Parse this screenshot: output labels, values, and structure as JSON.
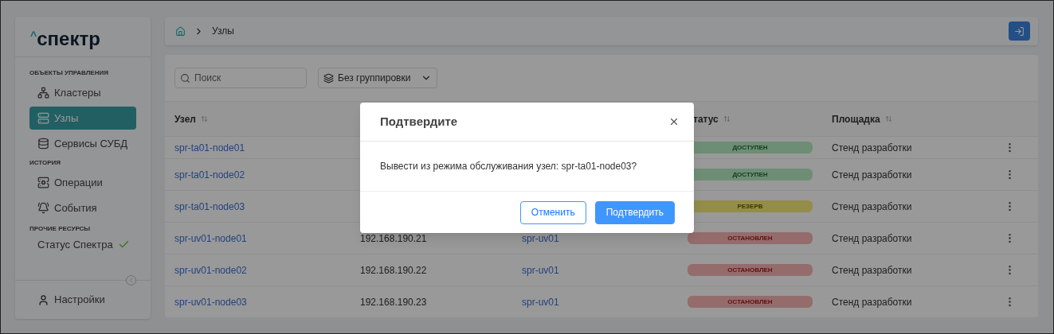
{
  "sidebar": {
    "logo": {
      "mark": "^",
      "name": "спектр"
    },
    "sections": [
      {
        "title": "ОБЪЕКТЫ УПРАВЛЕНИЯ",
        "items": [
          {
            "label": "Кластеры",
            "selected": false
          },
          {
            "label": "Узлы",
            "selected": true
          },
          {
            "label": "Сервисы СУБД",
            "selected": false
          }
        ]
      },
      {
        "title": "ИСТОРИЯ",
        "items": [
          {
            "label": "Операции",
            "selected": false
          },
          {
            "label": "События",
            "selected": false
          }
        ]
      },
      {
        "title": "ПРОЧИЕ РЕСУРСЫ",
        "items": [
          {
            "label": "Статус Спектра",
            "selected": false
          }
        ]
      }
    ],
    "settings": "Настройки"
  },
  "breadcrumb": {
    "current": "Узлы"
  },
  "toolbar": {
    "search": {
      "placeholder": "Поиск"
    },
    "grouping": "Без группировки"
  },
  "table": {
    "columns": [
      {
        "label": "Узел"
      },
      null,
      null,
      {
        "label": "татус"
      },
      {
        "label": "Площадка"
      }
    ],
    "rows": [
      {
        "node": "spr-ta01-node01",
        "status": {
          "kind": "available",
          "label": "ДОСТУПЕН"
        },
        "site": "Стенд разработки"
      },
      {
        "node": "spr-ta01-node02",
        "status": {
          "kind": "available",
          "label": "ДОСТУПЕН"
        },
        "site": "Стенд разработки"
      },
      {
        "node": "spr-ta01-node03",
        "status": {
          "kind": "reserve",
          "label": "РЕЗЕРВ"
        },
        "site": "Стенд разработки"
      },
      {
        "node": "spr-uv01-node01",
        "ip": "192.168.190.21",
        "cluster": "spr-uv01",
        "status": {
          "kind": "stopped",
          "label": "ОСТАНОВЛЕН"
        },
        "site": "Стенд разработки"
      },
      {
        "node": "spr-uv01-node02",
        "ip": "192.168.190.22",
        "cluster": "spr-uv01",
        "status": {
          "kind": "stopped",
          "label": "ОСТАНОВЛЕН"
        },
        "site": "Стенд разработки"
      },
      {
        "node": "spr-uv01-node03",
        "ip": "192.168.190.23",
        "cluster": "spr-uv01",
        "status": {
          "kind": "stopped",
          "label": "ОСТАНОВЛЕН"
        },
        "site": "Стенд разработки"
      }
    ]
  },
  "dialog": {
    "title": "Подтвердите",
    "message": "Вывести из режима обслуживания узел: spr-ta01-node03?",
    "buttons": [
      {
        "kind": "secondary",
        "label": "Отменить"
      },
      {
        "kind": "primary",
        "label": "Подтвердить"
      }
    ]
  }
}
